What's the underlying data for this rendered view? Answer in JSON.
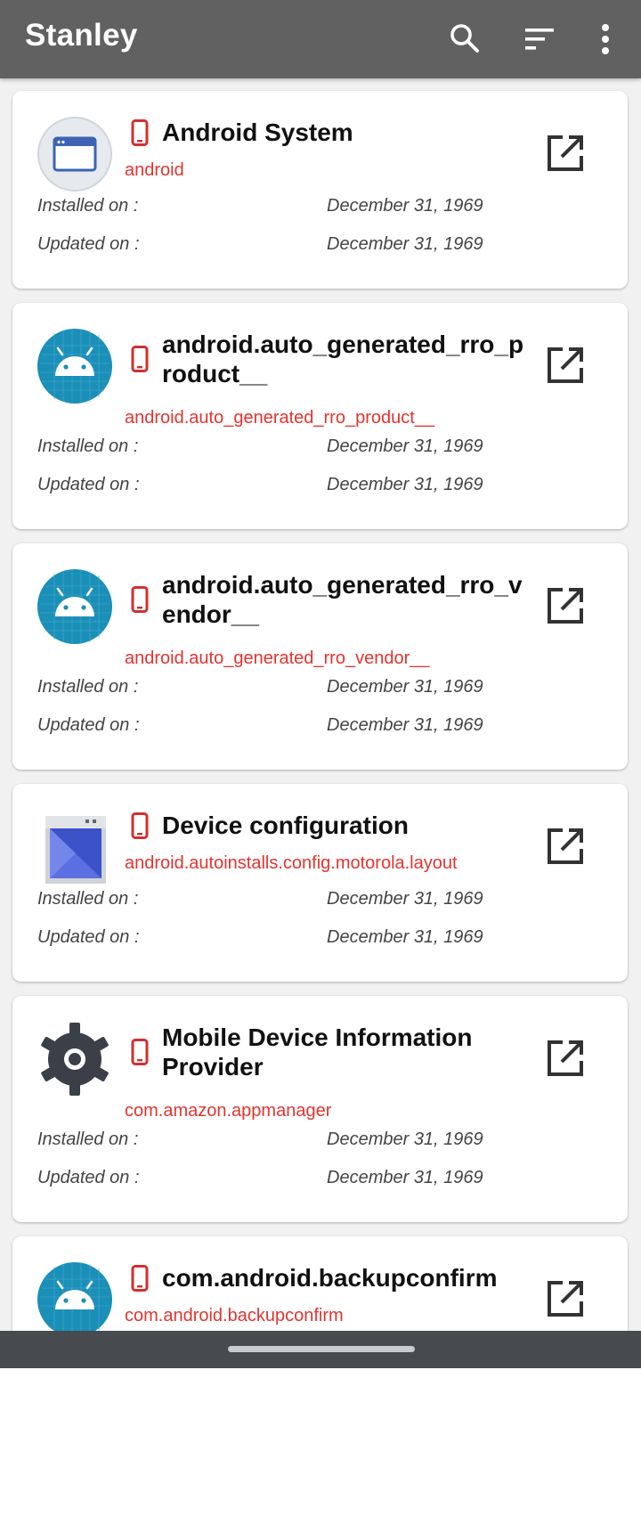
{
  "appbar": {
    "title": "Stanley",
    "actions": [
      {
        "icon": "search-icon"
      },
      {
        "icon": "sort-icon"
      },
      {
        "icon": "more-vert-icon"
      }
    ]
  },
  "labels": {
    "installed": "Installed on :",
    "updated": "Updated on :"
  },
  "apps": [
    {
      "name": "Android System",
      "package": "android",
      "installed_on": "December 31, 1969",
      "updated_on": "December 31, 1969",
      "icon": "window-app-icon"
    },
    {
      "name": "android.auto_generated_rro_product__",
      "package": "android.auto_generated_rro_product__",
      "installed_on": "December 31, 1969",
      "updated_on": "December 31, 1969",
      "icon": "android-robot-icon"
    },
    {
      "name": "android.auto_generated_rro_vendor__",
      "package": "android.auto_generated_rro_vendor__",
      "installed_on": "December 31, 1969",
      "updated_on": "December 31, 1969",
      "icon": "android-robot-icon"
    },
    {
      "name": "Device configuration",
      "package": "android.autoinstalls.config.motorola.layout",
      "installed_on": "December 31, 1969",
      "updated_on": "December 31, 1969",
      "icon": "device-config-icon"
    },
    {
      "name": "Mobile Device Information Provider",
      "package": "com.amazon.appmanager",
      "installed_on": "December 31, 1969",
      "updated_on": "December 31, 1969",
      "icon": "gear-icon"
    },
    {
      "name": "com.android.backupconfirm",
      "package": "com.android.backupconfirm",
      "icon": "android-robot-icon"
    }
  ],
  "colors": {
    "appbar": "#616161",
    "accent_red": "#e3342f",
    "android_teal": "#1a8fb8",
    "navbar": "#474b4e"
  }
}
